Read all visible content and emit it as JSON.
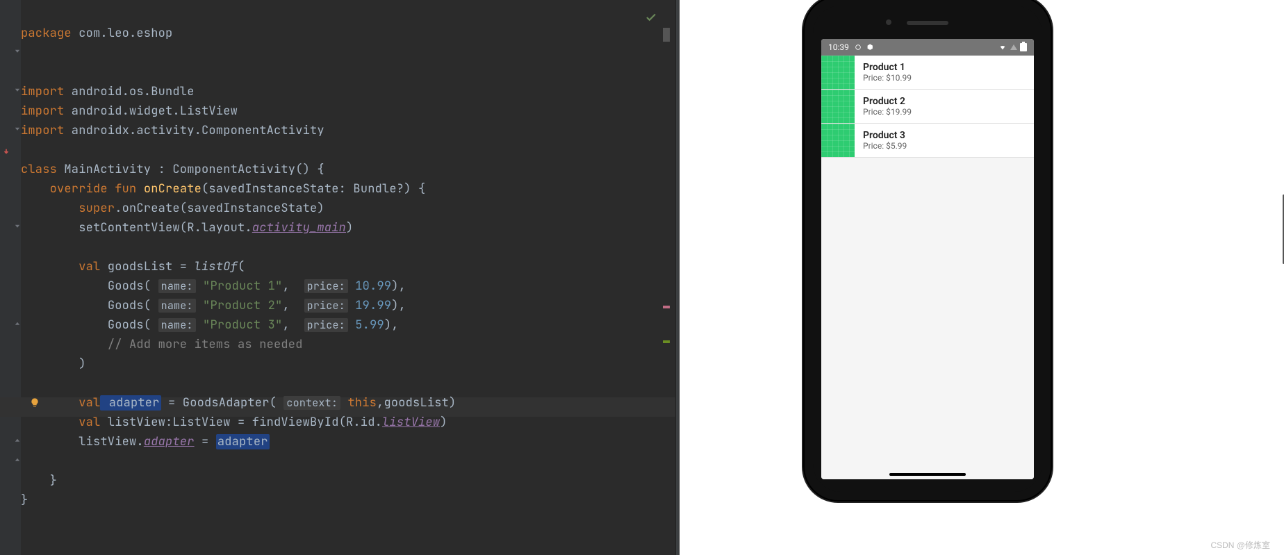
{
  "code": {
    "package_kw": "package",
    "package_name": " com.leo.eshop",
    "import_kw": "import",
    "import1": " android.os.Bundle",
    "import2": " android.widget.ListView",
    "import3": " androidx.activity.ComponentActivity",
    "class_kw": "class",
    "class_name": " MainActivity : ComponentActivity() {",
    "override_kw": "override",
    "fun_kw": "fun",
    "oncreate": "onCreate",
    "oncreate_params": "(savedInstanceState: Bundle?) {",
    "super_kw": "super",
    "super_call": ".onCreate(savedInstanceState)",
    "setcontent": "        setContentView(R.layout.",
    "activity_main": "activity_main",
    "setcontent_close": ")",
    "val_kw": "val",
    "goodslist": " goodsList = ",
    "listof": "listOf",
    "listof_open": "(",
    "goods_ctor": "Goods(",
    "hint_name": "name:",
    "hint_price": "price:",
    "p1": "\"Product 1\"",
    "p2": "\"Product 2\"",
    "p3": "\"Product 3\"",
    "v1": "10.99",
    "v2": "19.99",
    "v3": "5.99",
    "goods_close": "),",
    "add_comment": "// Add more items as needed",
    "close_paren": ")",
    "adapter_var": " adapter",
    "adapter_eq": " = GoodsAdapter(",
    "hint_context": "context:",
    "this_kw": "this",
    "adapter_tail": ",goodsList)",
    "listview_decl": " listView:ListView = findViewById(R.id.",
    "listview_id": "listView",
    "listview_decl_close": ")",
    "lv_assign_a": "listView.",
    "lv_adapter_prop": "adapter",
    "lv_assign_eq": " = ",
    "lv_adapter_hl": "adapter",
    "brace_close": "}"
  },
  "phone": {
    "time": "10:39",
    "items": [
      {
        "title": "Product 1",
        "sub": "Price: $10.99"
      },
      {
        "title": "Product 2",
        "sub": "Price: $19.99"
      },
      {
        "title": "Product 3",
        "sub": "Price: $5.99"
      }
    ]
  },
  "watermark": "CSDN @修炼室"
}
